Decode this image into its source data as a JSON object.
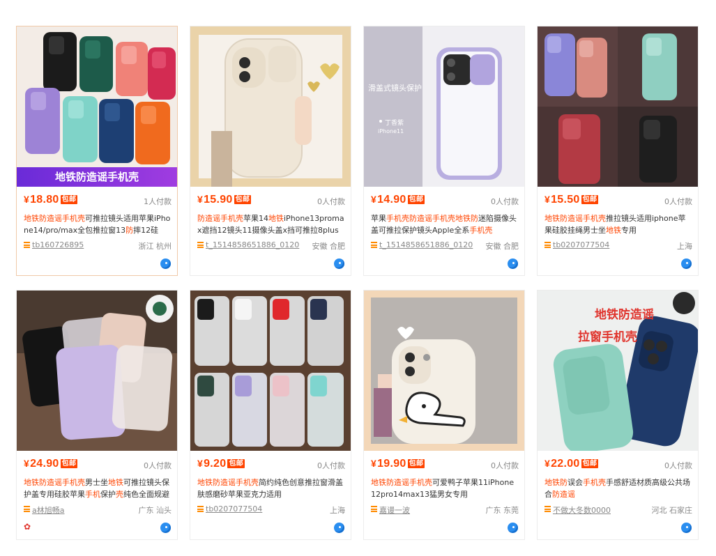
{
  "colors": {
    "accent": "#ff4400",
    "ww_blue": "#2a8ef0",
    "shop_icon": "#ff8a00"
  },
  "products": [
    {
      "price_symbol": "¥",
      "price": "18.80",
      "badge": "包邮",
      "paid": "1人付款",
      "title_parts": [
        {
          "t": "地铁防造谣手机壳",
          "hl": true
        },
        {
          "t": "可推拉镜头适用苹果iPhone14/pro/max全包推拉窗13",
          "hl": false
        },
        {
          "t": "防",
          "hl": true
        },
        {
          "t": "摔12硅",
          "hl": false
        }
      ],
      "shop": "tb160726895",
      "location": "浙江 杭州",
      "image_caption": "地铁防造谣手机壳"
    },
    {
      "price_symbol": "¥",
      "price": "15.90",
      "badge": "包邮",
      "paid": "0人付款",
      "title_parts": [
        {
          "t": "防造谣手机壳",
          "hl": true
        },
        {
          "t": "苹果14",
          "hl": false
        },
        {
          "t": "地铁",
          "hl": true
        },
        {
          "t": "iPhone13promax遮挡12镜头11摄像头盖x挡可推拉8plus保护",
          "hl": false
        }
      ],
      "shop": "t_1514858651886_0120",
      "location": "安徽 合肥"
    },
    {
      "price_symbol": "¥",
      "price": "14.90",
      "badge": "包邮",
      "paid": "0人付款",
      "title_parts": [
        {
          "t": "苹果",
          "hl": false
        },
        {
          "t": "手机壳防造谣手机壳地铁防",
          "hl": true
        },
        {
          "t": "迷陷摄像头盖可推拉保护镜头Apple全系",
          "hl": false
        },
        {
          "t": "手机壳",
          "hl": true
        }
      ],
      "shop": "t_1514858651886_0120",
      "location": "安徽 合肥",
      "image_caption": "滑盖式镜头保护",
      "image_sub1": "丁香紫",
      "image_sub2": "iPhone11"
    },
    {
      "price_symbol": "¥",
      "price": "15.50",
      "badge": "包邮",
      "paid": "0人付款",
      "title_parts": [
        {
          "t": "地铁防造谣手机壳",
          "hl": true
        },
        {
          "t": "推拉镜头适用iphone苹果硅胶挂绳男士坐",
          "hl": false
        },
        {
          "t": "地铁",
          "hl": true
        },
        {
          "t": "专用",
          "hl": false
        }
      ],
      "shop": "tb0207077504",
      "location": "上海"
    },
    {
      "price_symbol": "¥",
      "price": "24.90",
      "badge": "包邮",
      "paid": "0人付款",
      "title_parts": [
        {
          "t": "地铁防造谣手机壳",
          "hl": true
        },
        {
          "t": "男士坐",
          "hl": false
        },
        {
          "t": "地铁",
          "hl": true
        },
        {
          "t": "可推拉镜头保护盖专用硅胶苹果",
          "hl": false
        },
        {
          "t": "手机",
          "hl": true
        },
        {
          "t": "保护",
          "hl": false
        },
        {
          "t": "壳",
          "hl": true
        },
        {
          "t": "纯色全面规避",
          "hl": false
        }
      ],
      "shop": "a林旭畅a",
      "location": "广东 汕头"
    },
    {
      "price_symbol": "¥",
      "price": "9.20",
      "badge": "包邮",
      "paid": "0人付款",
      "title_parts": [
        {
          "t": "地铁防造谣手机壳",
          "hl": true
        },
        {
          "t": "简约纯色创意推拉窗滑盖肤感磨砂苹果亚克力适用",
          "hl": false
        }
      ],
      "shop": "tb0207077504",
      "location": "上海"
    },
    {
      "price_symbol": "¥",
      "price": "19.90",
      "badge": "包邮",
      "paid": "0人付款",
      "title_parts": [
        {
          "t": "地铁防造谣手机壳",
          "hl": true
        },
        {
          "t": "可爱鸭子苹果11iPhone12pro14max13猛男女专用",
          "hl": false
        }
      ],
      "shop": "嘉谩一波",
      "location": "广东 东莞"
    },
    {
      "price_symbol": "¥",
      "price": "22.00",
      "badge": "包邮",
      "paid": "0人付款",
      "title_parts": [
        {
          "t": "地铁防",
          "hl": true
        },
        {
          "t": "误会",
          "hl": false
        },
        {
          "t": "手机壳",
          "hl": true
        },
        {
          "t": "手感舒适材质高级公共场合",
          "hl": false
        },
        {
          "t": "防造谣",
          "hl": true
        }
      ],
      "shop": "不做大冬数0000",
      "location": "河北 石家庄",
      "image_caption": "地铁防造谣",
      "image_caption2": "拉窗手机壳"
    }
  ]
}
